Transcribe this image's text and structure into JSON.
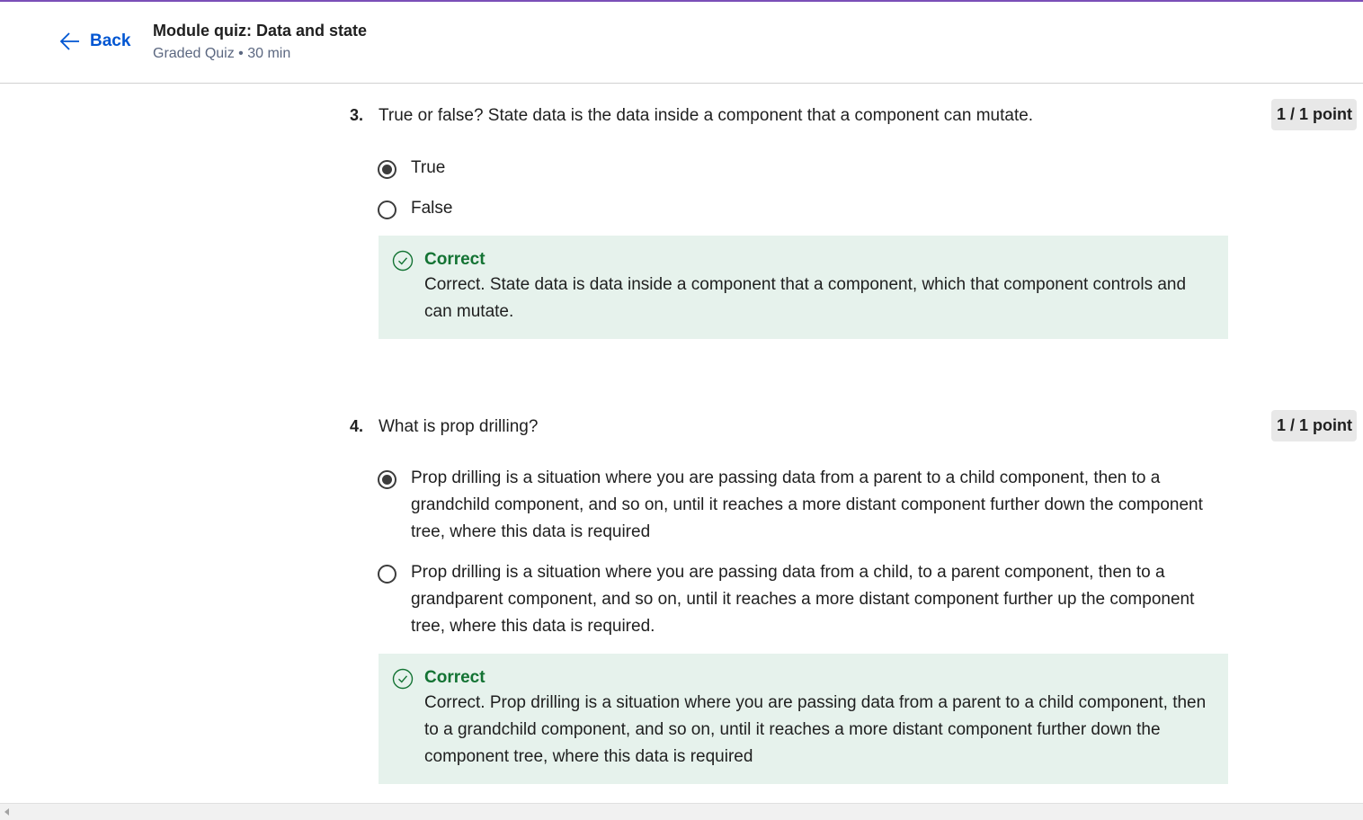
{
  "header": {
    "back_label": "Back",
    "title": "Module quiz: Data and state",
    "meta": "Graded Quiz • 30 min"
  },
  "questions": [
    {
      "number": "3.",
      "text": "True or false? State data is the data inside a component that a component can mutate.",
      "points": "1 / 1 point",
      "options": [
        {
          "label": "True",
          "selected": true
        },
        {
          "label": "False",
          "selected": false
        }
      ],
      "feedback": {
        "title": "Correct",
        "text": "Correct. State data is data inside a component that a component, which that component controls and can mutate."
      }
    },
    {
      "number": "4.",
      "text": "What is prop drilling?",
      "points": "1 / 1 point",
      "options": [
        {
          "label": "Prop drilling is a situation where you are passing data from a parent to a child component, then to a grandchild component, and so on, until it reaches a more distant component further down the component tree, where this data is required",
          "selected": true
        },
        {
          "label": "Prop drilling is a situation where you are passing data from a child, to a parent component, then to a grandparent component, and so on, until it reaches a more distant component further up the component tree, where this data is required.",
          "selected": false
        }
      ],
      "feedback": {
        "title": "Correct",
        "text": "Correct. Prop drilling is a situation where you are passing data from a parent to a child component, then to a grandchild component, and so on, until it reaches a more distant component further down the component tree, where this data is required"
      }
    }
  ],
  "colors": {
    "accent": "#7b4fb8",
    "link": "#0056d2",
    "correct": "#137333",
    "feedback_bg": "#e6f2ec"
  }
}
